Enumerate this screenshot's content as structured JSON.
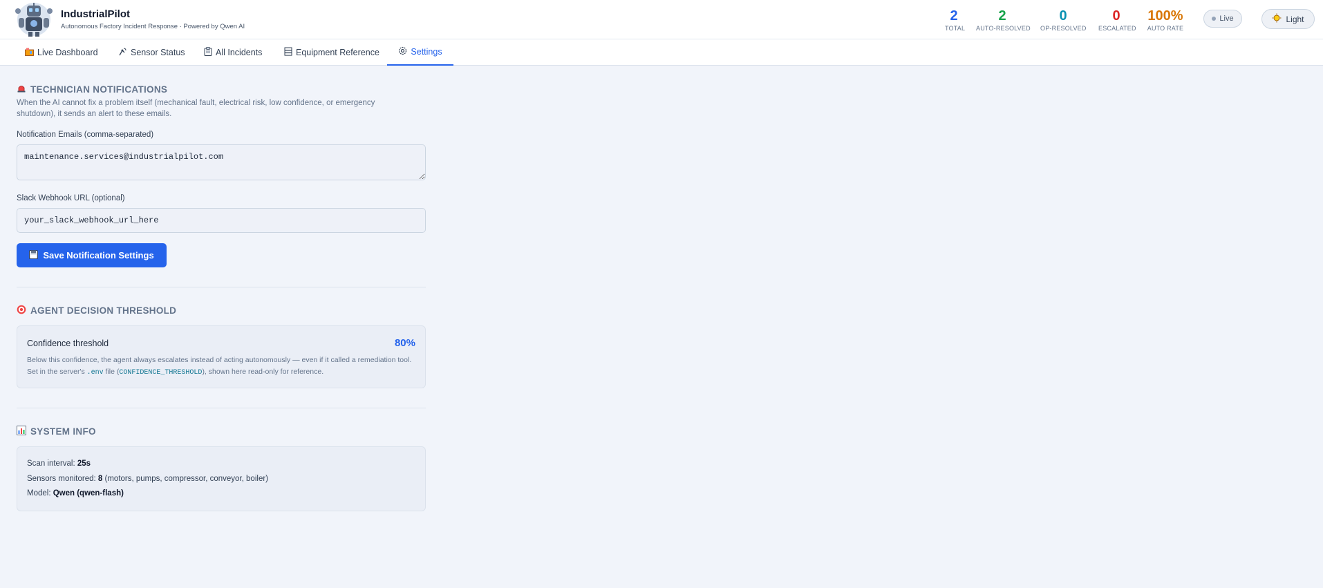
{
  "header": {
    "title": "IndustrialPilot",
    "subtitle": "Autonomous Factory Incident Response · Powered by Qwen AI"
  },
  "stats": [
    {
      "value": "2",
      "label": "TOTAL",
      "color": "#2563eb"
    },
    {
      "value": "2",
      "label": "AUTO-RESOLVED",
      "color": "#16a34a"
    },
    {
      "value": "0",
      "label": "OP-RESOLVED",
      "color": "#0891b2"
    },
    {
      "value": "0",
      "label": "ESCALATED",
      "color": "#dc2626"
    },
    {
      "value": "100%",
      "label": "AUTO RATE",
      "color": "#d97706"
    }
  ],
  "status": {
    "live_label": "Live",
    "theme_label": "Light",
    "theme_icon": "sun-icon"
  },
  "tabs": [
    {
      "label": "Live Dashboard",
      "icon": "dashboard-icon"
    },
    {
      "label": "Sensor Status",
      "icon": "sensor-icon"
    },
    {
      "label": "All Incidents",
      "icon": "clipboard-icon"
    },
    {
      "label": "Equipment Reference",
      "icon": "database-icon"
    },
    {
      "label": "Settings",
      "icon": "gear-icon",
      "active": true
    }
  ],
  "notifications": {
    "title": "TECHNICIAN NOTIFICATIONS",
    "icon": "siren-icon",
    "description": "When the AI cannot fix a problem itself (mechanical fault, electrical risk, low confidence, or emergency shutdown), it sends an alert to these emails.",
    "emails_label": "Notification Emails (comma-separated)",
    "emails_value": "maintenance.services@industrialpilot.com",
    "slack_label": "Slack Webhook URL (optional)",
    "slack_value": "your_slack_webhook_url_here",
    "save_label": "Save Notification Settings",
    "save_icon": "floppy-disk-icon"
  },
  "threshold": {
    "title": "AGENT DECISION THRESHOLD",
    "icon": "target-icon",
    "label": "Confidence threshold",
    "value": "80%",
    "note_part1": "Below this confidence, the agent always escalates instead of acting autonomously — even if it called a remediation tool. Set in the server's ",
    "note_code1": ".env",
    "note_part2": " file (",
    "note_code2": "CONFIDENCE_THRESHOLD",
    "note_part3": "), shown here read-only for reference."
  },
  "system_info": {
    "title": "SYSTEM INFO",
    "icon": "bar-chart-icon",
    "scan_label": "Scan interval: ",
    "scan_value": "25s",
    "sensors_label": "Sensors monitored: ",
    "sensors_value": "8",
    "sensors_detail": " (motors, pumps, compressor, conveyor, boiler)",
    "model_label": "Model: ",
    "model_value": "Qwen (qwen-flash)"
  }
}
